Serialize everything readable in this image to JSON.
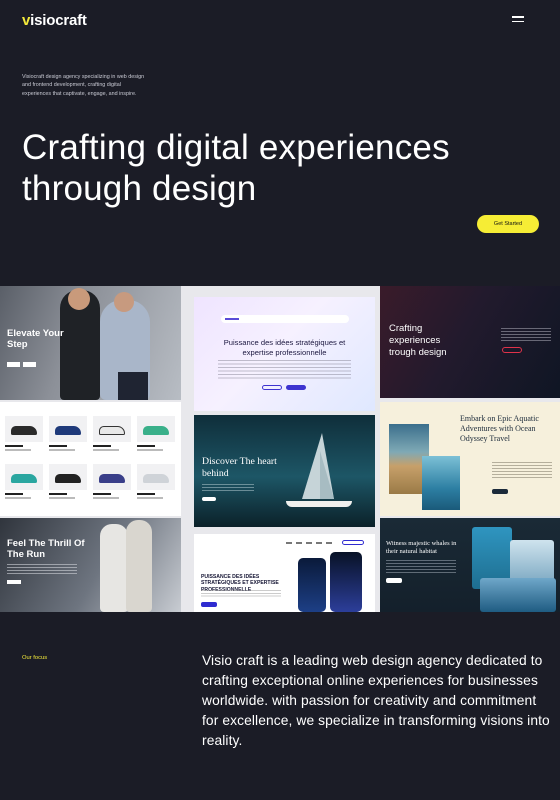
{
  "header": {
    "logo_text": "visiocraft",
    "menu_icon": "hamburger-icon"
  },
  "hero": {
    "intro": "Visiocraft design agency specializing in web design and frontend development, crafting digital experiences that captivate, engage, and inspire.",
    "headline": "Crafting digital experiences through design",
    "cta_label": "Get Started"
  },
  "colors": {
    "background": "#1b1c26",
    "accent": "#f3e93a",
    "button": "#f6ed35"
  },
  "gallery": {
    "fitness_title": "Elevate Your Step",
    "run_title": "Feel The Thrill Of The Run",
    "agency_title": "Puissance des idées stratégiques et expertise professionnelle",
    "boat_title": "Discover The heart behind",
    "white_title": "PUISSANCE DES IDÉES STRATÉGIQUES ET EXPERTISE PROFESSIONNELLE",
    "dark_title": "Crafting experiences trough design",
    "travel_title": "Embark on Epic Aquatic Adventures with Ocean Odyssey Travel",
    "whale_title": "Witness majestic whales in their natural habitat"
  },
  "focus": {
    "label": "Our focus",
    "text": "Visio craft is a leading web design agency dedicated to crafting exceptional online experiences for businesses worldwide. with passion for creativity and commitment for excellence, we specialize in transforming visions into reality."
  }
}
